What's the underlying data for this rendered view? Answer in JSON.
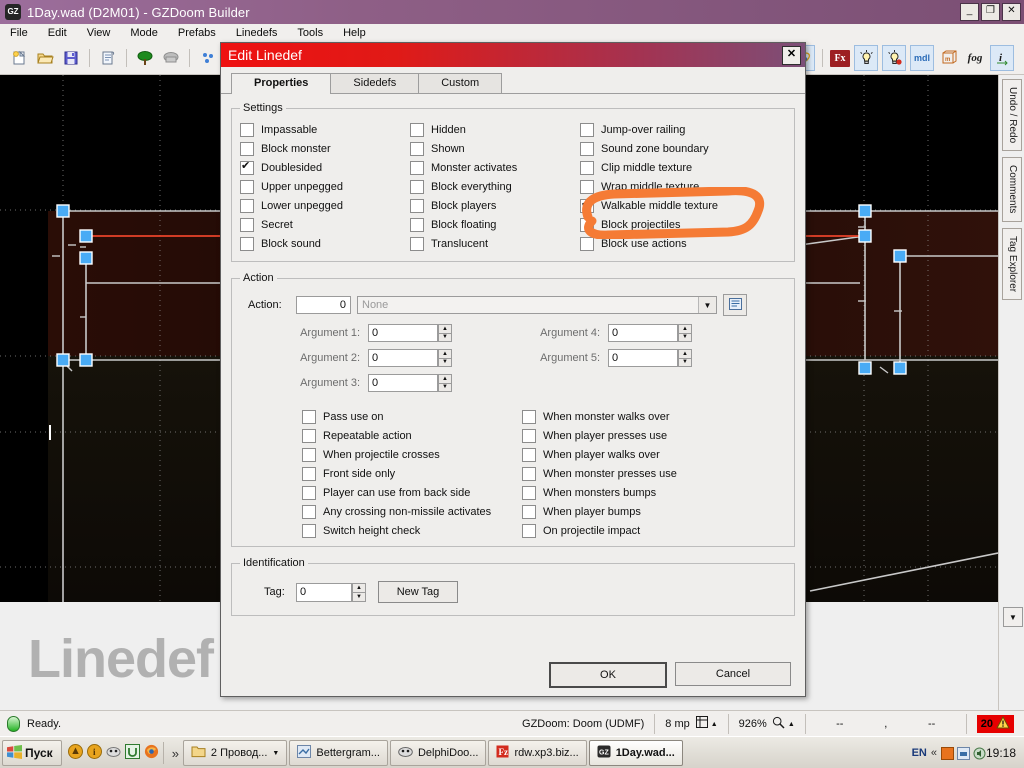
{
  "window": {
    "title": "1Day.wad (D2M01) - GZDoom Builder",
    "icon": "gz-logo-icon",
    "buttons": {
      "minimize": "_",
      "restore": "❐",
      "close": "✕"
    }
  },
  "menu": [
    "File",
    "Edit",
    "View",
    "Mode",
    "Prefabs",
    "Linedefs",
    "Tools",
    "Help"
  ],
  "toolbar_left": [
    "new-file-icon",
    "open-folder-icon",
    "save-disk-icon",
    "sep",
    "script-icon",
    "sep",
    "tree-icon",
    "rock-icon",
    "sep",
    "things-icon"
  ],
  "toolbar_right": [
    "dynamic-light-icon",
    "sep",
    "fx-icon",
    "light-bulb-icon",
    "light-bulb-red-icon",
    "model-icon",
    "model-box-icon",
    "fog-icon",
    "info-icon"
  ],
  "toolbar_labels": {
    "fx": "Fx",
    "mdl": "mdl",
    "mdl2": "mdl",
    "fog": "fog",
    "info": "i"
  },
  "dock_tabs": [
    "Undo / Redo",
    "Comments",
    "Tag Explorer"
  ],
  "map": {
    "watermark": "Linedef"
  },
  "statusbar": {
    "status": "Ready.",
    "game_config": "GZDoom: Doom (UDMF)",
    "memory": "8 mp",
    "zoom": "926%",
    "coord_x": "--",
    "coord_separator": ",",
    "coord_y": "--",
    "warning_count": "20"
  },
  "taskbar": {
    "start": "Пуск",
    "overflow": "»",
    "items": [
      {
        "label": "2 Провод...",
        "icon": "folder-icon",
        "active": false,
        "dropdown": true
      },
      {
        "label": "Bettergram...",
        "icon": "app-icon",
        "active": false,
        "dropdown": false
      },
      {
        "label": "DelphiDoo...",
        "icon": "delphi-icon",
        "active": false,
        "dropdown": false
      },
      {
        "label": "rdw.xp3.biz...",
        "icon": "fz-icon",
        "active": false,
        "dropdown": false
      },
      {
        "label": "1Day.wad...",
        "icon": "gz-logo-icon",
        "active": true,
        "dropdown": false
      }
    ],
    "lang": "EN",
    "tray_expand": "«",
    "clock": "19:18"
  },
  "dialog": {
    "title": "Edit Linedef",
    "close_label": "✕",
    "tabs": [
      {
        "label": "Properties",
        "active": true
      },
      {
        "label": "Sidedefs",
        "active": false
      },
      {
        "label": "Custom",
        "active": false
      }
    ],
    "settings": {
      "legend": "Settings",
      "columns": [
        [
          {
            "label": "Impassable",
            "checked": false
          },
          {
            "label": "Block monster",
            "checked": false
          },
          {
            "label": "Doublesided",
            "checked": true
          },
          {
            "label": "Upper unpegged",
            "checked": false
          },
          {
            "label": "Lower unpegged",
            "checked": false
          },
          {
            "label": "Secret",
            "checked": false
          },
          {
            "label": "Block sound",
            "checked": false
          }
        ],
        [
          {
            "label": "Hidden",
            "checked": false
          },
          {
            "label": "Shown",
            "checked": false
          },
          {
            "label": "Monster activates",
            "checked": false
          },
          {
            "label": "Block everything",
            "checked": false
          },
          {
            "label": "Block players",
            "checked": false
          },
          {
            "label": "Block floating",
            "checked": false
          },
          {
            "label": "Translucent",
            "checked": false
          }
        ],
        [
          {
            "label": "Jump-over railing",
            "checked": false
          },
          {
            "label": "Sound zone boundary",
            "checked": false
          },
          {
            "label": "Clip middle texture",
            "checked": false
          },
          {
            "label": "Wrap middle texture",
            "checked": false
          },
          {
            "label": "Walkable middle texture",
            "checked": true
          },
          {
            "label": "Block projectiles",
            "checked": false
          },
          {
            "label": "Block use actions",
            "checked": false
          }
        ]
      ]
    },
    "action": {
      "legend": "Action",
      "action_label": "Action:",
      "action_number": "0",
      "action_name_placeholder": "None",
      "browse_icon": "list-browse-icon",
      "arguments": [
        {
          "label": "Argument 1:",
          "value": "0"
        },
        {
          "label": "Argument 2:",
          "value": "0"
        },
        {
          "label": "Argument 3:",
          "value": "0"
        },
        {
          "label": "Argument 4:",
          "value": "0"
        },
        {
          "label": "Argument 5:",
          "value": "0"
        }
      ],
      "activation_columns": [
        [
          {
            "label": "Pass use on",
            "checked": false
          },
          {
            "label": "Repeatable action",
            "checked": false
          },
          {
            "label": "When projectile crosses",
            "checked": false
          },
          {
            "label": "Front side only",
            "checked": false
          },
          {
            "label": "Player can use from back side",
            "checked": false
          },
          {
            "label": "Any crossing non-missile activates",
            "checked": false
          },
          {
            "label": "Switch height check",
            "checked": false
          }
        ],
        [
          {
            "label": "When monster walks over",
            "checked": false
          },
          {
            "label": "When player presses use",
            "checked": false
          },
          {
            "label": "When player walks over",
            "checked": false
          },
          {
            "label": "When monster presses use",
            "checked": false
          },
          {
            "label": "When monsters bumps",
            "checked": false
          },
          {
            "label": "When player bumps",
            "checked": false
          },
          {
            "label": "On projectile impact",
            "checked": false
          }
        ]
      ]
    },
    "identification": {
      "legend": "Identification",
      "tag_label": "Tag:",
      "tag_value": "0",
      "new_tag_label": "New Tag"
    },
    "buttons": {
      "ok": "OK",
      "cancel": "Cancel"
    }
  },
  "annotation": {
    "color": "#f57b35",
    "target": "Walkable middle texture"
  }
}
